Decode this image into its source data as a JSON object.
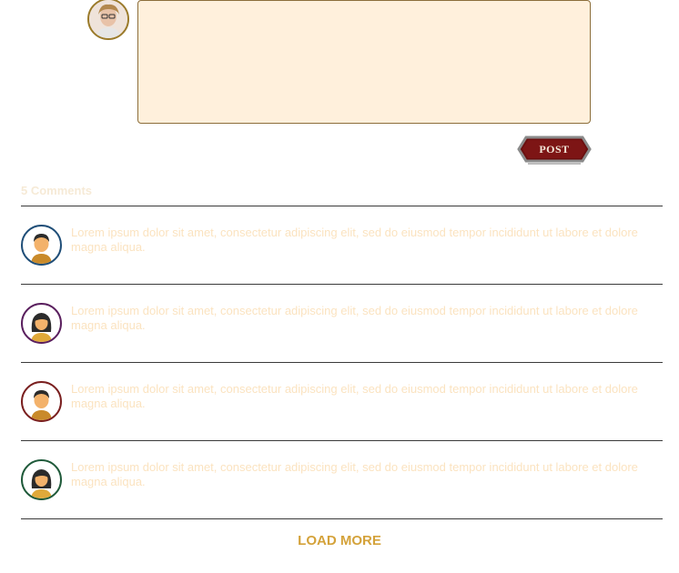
{
  "composer": {
    "post_label": "POST"
  },
  "comments_header": "5 Comments",
  "comments": [
    {
      "text": "Lorem ipsum dolor sit amet, consectetur adipiscing elit, sed do eiusmod tempor incididunt ut labore et dolore magna aliqua.",
      "avatar": "male-avatar-icon",
      "ring_color": "#1f4e78"
    },
    {
      "text": "Lorem ipsum dolor sit amet, consectetur adipiscing elit, sed do eiusmod tempor incididunt ut labore et dolore magna aliqua.",
      "avatar": "female-avatar-icon",
      "ring_color": "#5a1f5e"
    },
    {
      "text": "Lorem ipsum dolor sit amet, consectetur adipiscing elit, sed do eiusmod tempor incididunt ut labore et dolore magna aliqua.",
      "avatar": "male-avatar-icon",
      "ring_color": "#7a1f1f"
    },
    {
      "text": "Lorem ipsum dolor sit amet, consectetur adipiscing elit, sed do eiusmod tempor incididunt ut labore et dolore magna aliqua.",
      "avatar": "female-avatar-icon",
      "ring_color": "#1f5a3a"
    }
  ],
  "load_more_label": "LOAD MORE",
  "colors": {
    "accent": "#d4a23a",
    "comment_text": "#fbe3c0",
    "textarea_bg": "#fff0dc",
    "post_button": "#7a1212"
  }
}
